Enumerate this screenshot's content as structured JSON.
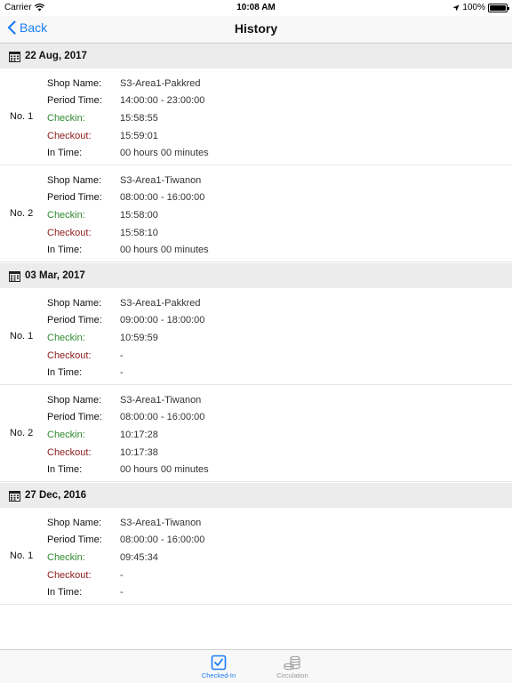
{
  "status": {
    "carrier": "Carrier",
    "time": "10:08 AM",
    "battery": "100%"
  },
  "nav": {
    "back_label": "Back",
    "title": "History"
  },
  "sections": [
    {
      "date": "22 Aug, 2017",
      "entries": [
        {
          "no": "No. 1",
          "shop_label": "Shop Name:",
          "shop": "S3-Area1-Pakkred",
          "period_label": "Period Time:",
          "period": "14:00:00 - 23:00:00",
          "checkin_label": "Checkin:",
          "checkin": "15:58:55",
          "checkout_label": "Checkout:",
          "checkout": "15:59:01",
          "intime_label": "In Time:",
          "intime": "00 hours 00 minutes"
        },
        {
          "no": "No. 2",
          "shop_label": "Shop Name:",
          "shop": "S3-Area1-Tiwanon",
          "period_label": "Period Time:",
          "period": "08:00:00 - 16:00:00",
          "checkin_label": "Checkin:",
          "checkin": "15:58:00",
          "checkout_label": "Checkout:",
          "checkout": "15:58:10",
          "intime_label": "In Time:",
          "intime": "00 hours 00 minutes"
        }
      ]
    },
    {
      "date": "03 Mar, 2017",
      "entries": [
        {
          "no": "No. 1",
          "shop_label": "Shop Name:",
          "shop": "S3-Area1-Pakkred",
          "period_label": "Period Time:",
          "period": "09:00:00 - 18:00:00",
          "checkin_label": "Checkin:",
          "checkin": "10:59:59",
          "checkout_label": "Checkout:",
          "checkout": "-",
          "intime_label": "In Time:",
          "intime": "-"
        },
        {
          "no": "No. 2",
          "shop_label": "Shop Name:",
          "shop": "S3-Area1-Tiwanon",
          "period_label": "Period Time:",
          "period": "08:00:00 - 16:00:00",
          "checkin_label": "Checkin:",
          "checkin": "10:17:28",
          "checkout_label": "Checkout:",
          "checkout": "10:17:38",
          "intime_label": "In Time:",
          "intime": "00 hours 00 minutes"
        }
      ]
    },
    {
      "date": "27 Dec, 2016",
      "entries": [
        {
          "no": "No. 1",
          "shop_label": "Shop Name:",
          "shop": "S3-Area1-Tiwanon",
          "period_label": "Period Time:",
          "period": "08:00:00 - 16:00:00",
          "checkin_label": "Checkin:",
          "checkin": "09:45:34",
          "checkout_label": "Checkout:",
          "checkout": "-",
          "intime_label": "In Time:",
          "intime": "-"
        }
      ]
    }
  ],
  "tabs": [
    {
      "label": "Checked-In",
      "icon": "checkbox-icon",
      "active": true
    },
    {
      "label": "Circulation",
      "icon": "coins-icon",
      "active": false
    }
  ],
  "colors": {
    "accent": "#1a7cf5",
    "checkin": "#2f8a2f",
    "checkout": "#8b1a1a",
    "section_bg": "#ececec"
  }
}
